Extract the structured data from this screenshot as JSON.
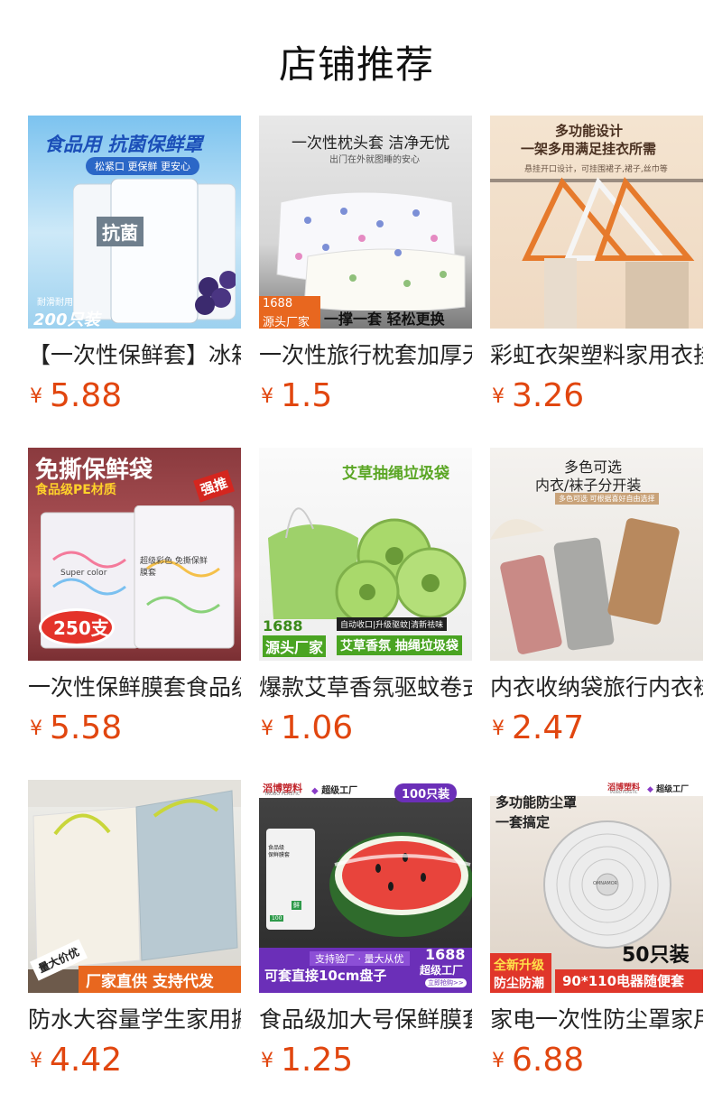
{
  "page": {
    "title": "店铺推荐"
  },
  "products": [
    {
      "name": "【一次性保鲜套】冰箱",
      "currency": "¥",
      "price": "5.88",
      "image": {
        "headline": "食品用 抗菌保鲜罩",
        "sub": "松紧口 更保鲜 更安心",
        "badge_top": "耐滑耐用",
        "badge": "200只装",
        "pack": "抗菌"
      }
    },
    {
      "name": "一次性旅行枕套加厚无",
      "currency": "¥",
      "price": "1.5",
      "image": {
        "headline": "一次性枕头套 洁净无忧",
        "sub": "出门在外就图睡的安心",
        "badge1": "1688",
        "badge2": "源头厂家",
        "tagline": "一撑一套 轻松更换"
      }
    },
    {
      "name": "彩虹衣架塑料家用衣挂",
      "currency": "¥",
      "price": "3.26",
      "image": {
        "headline1": "多功能设计",
        "headline2": "一架多用满足挂衣所需",
        "sub": "悬挂开口设计，可挂围裙子,裙子,丝巾等"
      }
    },
    {
      "name": "一次性保鲜膜套食品级",
      "currency": "¥",
      "price": "5.58",
      "image": {
        "headline": "免撕保鲜袋",
        "sub": "食品级PE材质",
        "stamp": "强推",
        "badge": "250支",
        "bag1": "Super color",
        "bag2": "超级彩色 免撕保鲜膜套"
      }
    },
    {
      "name": "爆款艾草香氛驱蚊卷式",
      "currency": "¥",
      "price": "1.06",
      "image": {
        "headline": "艾草抽绳垃圾袋",
        "caption": "自动收口|升级驱蚊|清新祛味",
        "badge1": "1688",
        "badge2": "源头厂家",
        "tagline": "艾草香氛 抽绳垃圾袋"
      }
    },
    {
      "name": "内衣收纳袋旅行内衣袜",
      "currency": "¥",
      "price": "2.47",
      "image": {
        "headline1": "多色可选",
        "headline2": "内衣/袜子分开装",
        "sub": "多色可选 可根据喜好自由选择"
      }
    },
    {
      "name": "防水大容量学生家用搬",
      "currency": "¥",
      "price": "4.42",
      "image": {
        "stamp": "量大价优",
        "tagline": "厂家直供 支持代发"
      }
    },
    {
      "name": "食品级加大号保鲜膜套",
      "currency": "¥",
      "price": "1.25",
      "image": {
        "brand": "滔博塑料",
        "brand_sub": "TAOBO PLASTIC",
        "factory": "超级工厂",
        "count": "100只装",
        "pack1": "食品级",
        "pack2": "保鲜膜套",
        "pack_tag": "鲜",
        "pack_qty": "100",
        "ribbon": "支持验厂 · 量大从优",
        "tagline": "可套直接10cm盘子",
        "badge1": "1688",
        "badge2": "超级工厂",
        "badge3": "立即抢购>>"
      }
    },
    {
      "name": "家电一次性防尘罩家用",
      "currency": "¥",
      "price": "6.88",
      "image": {
        "brand": "滔博塑料",
        "brand_sub": "TAOBO PLASTIC",
        "factory": "超级工厂",
        "headline1": "多功能防尘罩",
        "headline2": "一套搞定",
        "count": "50只装",
        "promo1": "全新升级",
        "promo2": "防尘防潮",
        "tagline": "90*110电器随便套",
        "fan_label": "OMNAMOR"
      }
    }
  ]
}
